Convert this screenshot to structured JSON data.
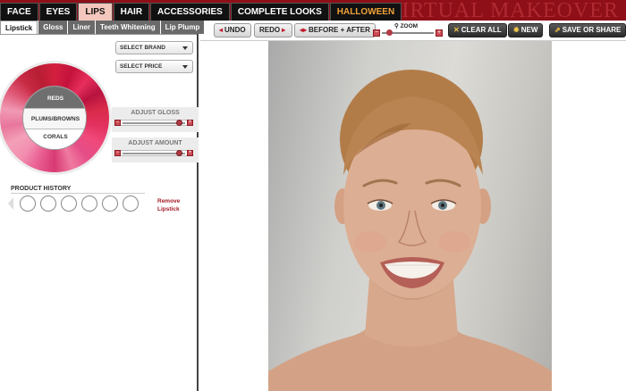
{
  "header": {
    "title": "VIRTUAL MAKEOVER",
    "nav": [
      "FACE",
      "EYES",
      "LIPS",
      "HAIR",
      "ACCESSORIES",
      "COMPLETE LOOKS",
      "HALLOWEEN"
    ],
    "active_nav": "LIPS"
  },
  "subtabs": [
    "Lipstick",
    "Gloss",
    "Liner",
    "Teeth Whitening",
    "Lip Plump"
  ],
  "filters": {
    "brand": "SELECT BRAND",
    "price": "SELECT PRICE"
  },
  "color_wheel": {
    "groups": [
      "REDS",
      "PLUMS/BROWNS",
      "CORALS"
    ],
    "selected": "REDS"
  },
  "adjust_gloss": {
    "label": "ADJUST GLOSS",
    "level": 0.92
  },
  "adjust_amount": {
    "label": "ADJUST AMOUNT",
    "level": 0.92
  },
  "product_history": {
    "title": "PRODUCT HISTORY",
    "remove_label": "Remove Lipstick",
    "slots": 6
  },
  "toolbar": {
    "undo": "UNDO",
    "redo": "REDO",
    "before_after": "BEFORE + AFTER",
    "zoom_label": "ZOOM",
    "zoom_level": 0.1,
    "clear_all": "CLEAR ALL",
    "new": "NEW",
    "save_share": "SAVE OR SHARE"
  },
  "colors": {
    "brand_red": "#8e0f17",
    "accent_red": "#c02030"
  }
}
